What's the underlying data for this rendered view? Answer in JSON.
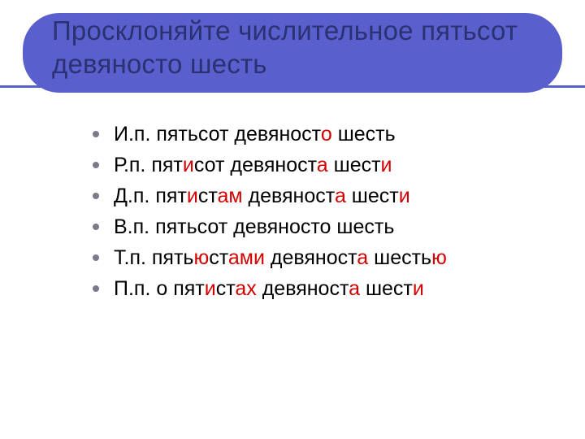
{
  "title": "Просклоняйте числительное пятьсот девяносто шесть",
  "cases": [
    {
      "label": "И.п.",
      "parts": [
        {
          "t": "пятьсот девяност"
        },
        {
          "t": "о",
          "hl": true
        },
        {
          "t": " шесть"
        }
      ]
    },
    {
      "label": "Р.п.",
      "parts": [
        {
          "t": "пят"
        },
        {
          "t": "и",
          "hl": true
        },
        {
          "t": "сот девяност"
        },
        {
          "t": "а",
          "hl": true
        },
        {
          "t": " шест"
        },
        {
          "t": "и",
          "hl": true
        }
      ]
    },
    {
      "label": "Д.п.",
      "parts": [
        {
          "t": "пят"
        },
        {
          "t": "и",
          "hl": true
        },
        {
          "t": "ст"
        },
        {
          "t": "ам",
          "hl": true
        },
        {
          "t": " девяност"
        },
        {
          "t": "а",
          "hl": true
        },
        {
          "t": " шест"
        },
        {
          "t": "и",
          "hl": true
        }
      ]
    },
    {
      "label": "В.п.",
      "parts": [
        {
          "t": "пятьсот девяносто шесть"
        }
      ]
    },
    {
      "label": "Т.п.",
      "parts": [
        {
          "t": "пять"
        },
        {
          "t": "ю",
          "hl": true
        },
        {
          "t": "ст"
        },
        {
          "t": "ами",
          "hl": true
        },
        {
          "t": " девяност"
        },
        {
          "t": "а",
          "hl": true
        },
        {
          "t": " шесть"
        },
        {
          "t": "ю",
          "hl": true
        }
      ]
    },
    {
      "label": "П.п.",
      "parts": [
        {
          "t": "о пят"
        },
        {
          "t": "и",
          "hl": true
        },
        {
          "t": "ст"
        },
        {
          "t": "ах",
          "hl": true
        },
        {
          "t": " девяност"
        },
        {
          "t": "а",
          "hl": true
        },
        {
          "t": " шест"
        },
        {
          "t": "и",
          "hl": true
        }
      ]
    }
  ]
}
